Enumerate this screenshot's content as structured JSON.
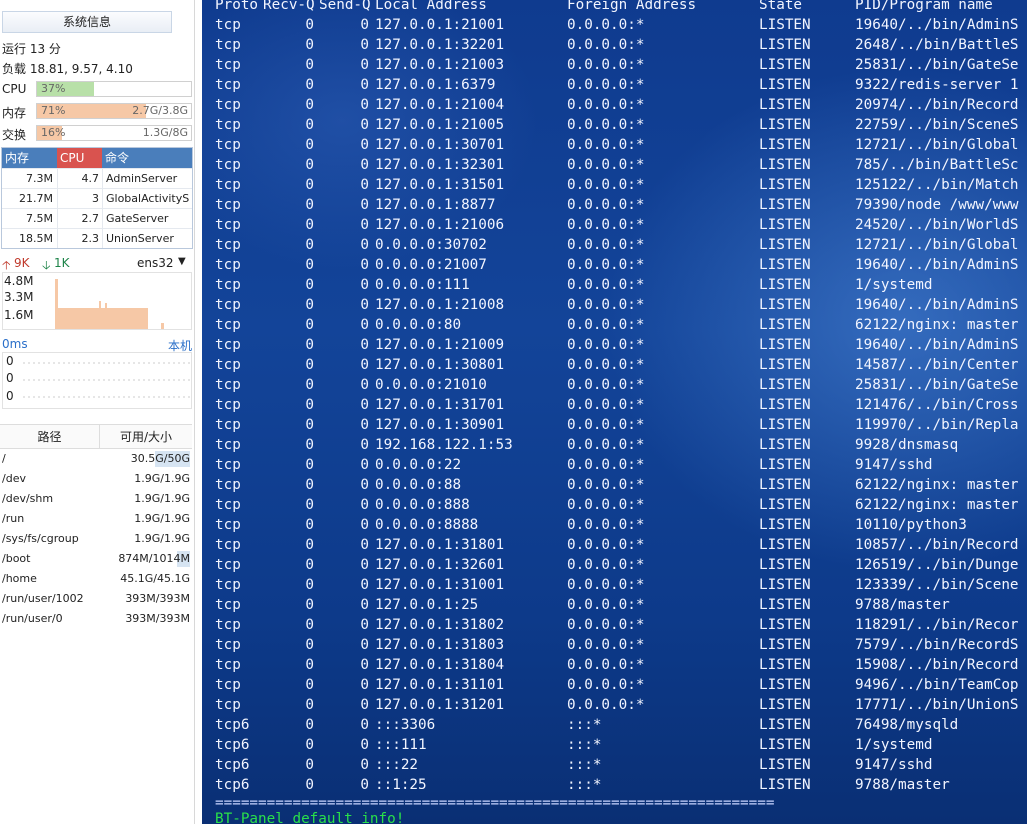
{
  "sidebar": {
    "sysinfo_button": "系统信息",
    "uptime": "运行 13 分",
    "load": "负载 18.81, 9.57, 4.10",
    "meters": [
      {
        "label": "CPU",
        "pct": "37%",
        "value": "",
        "fill": 0.37,
        "color": "#b8e0a8"
      },
      {
        "label": "内存",
        "pct": "71%",
        "value": "2.7G/3.8G",
        "fill": 0.71,
        "color": "#f6c8a6"
      },
      {
        "label": "交换",
        "pct": "16%",
        "value": "1.3G/8G",
        "fill": 0.16,
        "color": "#f6c8a6"
      }
    ],
    "process_table": {
      "headers": {
        "mem": "内存",
        "cpu": "CPU",
        "cmd": "命令"
      },
      "rows": [
        {
          "mem": "7.3M",
          "cpu": "4.7",
          "cmd": "AdminServer"
        },
        {
          "mem": "21.7M",
          "cpu": "3",
          "cmd": "GlobalActivityS"
        },
        {
          "mem": "7.5M",
          "cpu": "2.7",
          "cmd": "GateServer"
        },
        {
          "mem": "18.5M",
          "cpu": "2.3",
          "cmd": "UnionServer"
        }
      ]
    },
    "network": {
      "up": "9K",
      "down": "1K",
      "interface": "ens32",
      "y_labels": [
        "4.8M",
        "3.3M",
        "1.6M"
      ]
    },
    "ping": {
      "latency": "0ms",
      "host": "本机",
      "y_labels": [
        "0",
        "0",
        "0"
      ]
    },
    "disk": {
      "headers": {
        "path": "路径",
        "size": "可用/大小"
      },
      "rows": [
        {
          "path": "/",
          "size": "30.5G/50G",
          "fill": 0.39
        },
        {
          "path": "/dev",
          "size": "1.9G/1.9G",
          "fill": 0.0
        },
        {
          "path": "/dev/shm",
          "size": "1.9G/1.9G",
          "fill": 0.0
        },
        {
          "path": "/run",
          "size": "1.9G/1.9G",
          "fill": 0.0
        },
        {
          "path": "/sys/fs/cgroup",
          "size": "1.9G/1.9G",
          "fill": 0.0
        },
        {
          "path": "/boot",
          "size": "874M/1014M",
          "fill": 0.14
        },
        {
          "path": "/home",
          "size": "45.1G/45.1G",
          "fill": 0.0
        },
        {
          "path": "/run/user/1002",
          "size": "393M/393M",
          "fill": 0.0
        },
        {
          "path": "/run/user/0",
          "size": "393M/393M",
          "fill": 0.0
        }
      ]
    }
  },
  "terminal": {
    "headers": {
      "proto": "Proto",
      "recv": "Recv-Q",
      "send": "Send-Q",
      "local": "Local Address",
      "foreign": "Foreign Address",
      "state": "State",
      "pid": "PID/Program name"
    },
    "rows": [
      {
        "proto": "tcp",
        "recv": "0",
        "send": "0",
        "local": "127.0.0.1:21001",
        "foreign": "0.0.0.0:*",
        "state": "LISTEN",
        "pid": "19640/../bin/AdminS"
      },
      {
        "proto": "tcp",
        "recv": "0",
        "send": "0",
        "local": "127.0.0.1:32201",
        "foreign": "0.0.0.0:*",
        "state": "LISTEN",
        "pid": "2648/../bin/BattleS"
      },
      {
        "proto": "tcp",
        "recv": "0",
        "send": "0",
        "local": "127.0.0.1:21003",
        "foreign": "0.0.0.0:*",
        "state": "LISTEN",
        "pid": "25831/../bin/GateSe"
      },
      {
        "proto": "tcp",
        "recv": "0",
        "send": "0",
        "local": "127.0.0.1:6379",
        "foreign": "0.0.0.0:*",
        "state": "LISTEN",
        "pid": "9322/redis-server 1"
      },
      {
        "proto": "tcp",
        "recv": "0",
        "send": "0",
        "local": "127.0.0.1:21004",
        "foreign": "0.0.0.0:*",
        "state": "LISTEN",
        "pid": "20974/../bin/Record"
      },
      {
        "proto": "tcp",
        "recv": "0",
        "send": "0",
        "local": "127.0.0.1:21005",
        "foreign": "0.0.0.0:*",
        "state": "LISTEN",
        "pid": "22759/../bin/SceneS"
      },
      {
        "proto": "tcp",
        "recv": "0",
        "send": "0",
        "local": "127.0.0.1:30701",
        "foreign": "0.0.0.0:*",
        "state": "LISTEN",
        "pid": "12721/../bin/Global"
      },
      {
        "proto": "tcp",
        "recv": "0",
        "send": "0",
        "local": "127.0.0.1:32301",
        "foreign": "0.0.0.0:*",
        "state": "LISTEN",
        "pid": "785/../bin/BattleSc"
      },
      {
        "proto": "tcp",
        "recv": "0",
        "send": "0",
        "local": "127.0.0.1:31501",
        "foreign": "0.0.0.0:*",
        "state": "LISTEN",
        "pid": "125122/../bin/Match"
      },
      {
        "proto": "tcp",
        "recv": "0",
        "send": "0",
        "local": "127.0.0.1:8877",
        "foreign": "0.0.0.0:*",
        "state": "LISTEN",
        "pid": "79390/node /www/www"
      },
      {
        "proto": "tcp",
        "recv": "0",
        "send": "0",
        "local": "127.0.0.1:21006",
        "foreign": "0.0.0.0:*",
        "state": "LISTEN",
        "pid": "24520/../bin/WorldS"
      },
      {
        "proto": "tcp",
        "recv": "0",
        "send": "0",
        "local": "0.0.0.0:30702",
        "foreign": "0.0.0.0:*",
        "state": "LISTEN",
        "pid": "12721/../bin/Global"
      },
      {
        "proto": "tcp",
        "recv": "0",
        "send": "0",
        "local": "0.0.0.0:21007",
        "foreign": "0.0.0.0:*",
        "state": "LISTEN",
        "pid": "19640/../bin/AdminS"
      },
      {
        "proto": "tcp",
        "recv": "0",
        "send": "0",
        "local": "0.0.0.0:111",
        "foreign": "0.0.0.0:*",
        "state": "LISTEN",
        "pid": "1/systemd"
      },
      {
        "proto": "tcp",
        "recv": "0",
        "send": "0",
        "local": "127.0.0.1:21008",
        "foreign": "0.0.0.0:*",
        "state": "LISTEN",
        "pid": "19640/../bin/AdminS"
      },
      {
        "proto": "tcp",
        "recv": "0",
        "send": "0",
        "local": "0.0.0.0:80",
        "foreign": "0.0.0.0:*",
        "state": "LISTEN",
        "pid": "62122/nginx: master"
      },
      {
        "proto": "tcp",
        "recv": "0",
        "send": "0",
        "local": "127.0.0.1:21009",
        "foreign": "0.0.0.0:*",
        "state": "LISTEN",
        "pid": "19640/../bin/AdminS"
      },
      {
        "proto": "tcp",
        "recv": "0",
        "send": "0",
        "local": "127.0.0.1:30801",
        "foreign": "0.0.0.0:*",
        "state": "LISTEN",
        "pid": "14587/../bin/Center"
      },
      {
        "proto": "tcp",
        "recv": "0",
        "send": "0",
        "local": "0.0.0.0:21010",
        "foreign": "0.0.0.0:*",
        "state": "LISTEN",
        "pid": "25831/../bin/GateSe"
      },
      {
        "proto": "tcp",
        "recv": "0",
        "send": "0",
        "local": "127.0.0.1:31701",
        "foreign": "0.0.0.0:*",
        "state": "LISTEN",
        "pid": "121476/../bin/Cross"
      },
      {
        "proto": "tcp",
        "recv": "0",
        "send": "0",
        "local": "127.0.0.1:30901",
        "foreign": "0.0.0.0:*",
        "state": "LISTEN",
        "pid": "119970/../bin/Repla"
      },
      {
        "proto": "tcp",
        "recv": "0",
        "send": "0",
        "local": "192.168.122.1:53",
        "foreign": "0.0.0.0:*",
        "state": "LISTEN",
        "pid": "9928/dnsmasq"
      },
      {
        "proto": "tcp",
        "recv": "0",
        "send": "0",
        "local": "0.0.0.0:22",
        "foreign": "0.0.0.0:*",
        "state": "LISTEN",
        "pid": "9147/sshd"
      },
      {
        "proto": "tcp",
        "recv": "0",
        "send": "0",
        "local": "0.0.0.0:88",
        "foreign": "0.0.0.0:*",
        "state": "LISTEN",
        "pid": "62122/nginx: master"
      },
      {
        "proto": "tcp",
        "recv": "0",
        "send": "0",
        "local": "0.0.0.0:888",
        "foreign": "0.0.0.0:*",
        "state": "LISTEN",
        "pid": "62122/nginx: master"
      },
      {
        "proto": "tcp",
        "recv": "0",
        "send": "0",
        "local": "0.0.0.0:8888",
        "foreign": "0.0.0.0:*",
        "state": "LISTEN",
        "pid": "10110/python3"
      },
      {
        "proto": "tcp",
        "recv": "0",
        "send": "0",
        "local": "127.0.0.1:31801",
        "foreign": "0.0.0.0:*",
        "state": "LISTEN",
        "pid": "10857/../bin/Record"
      },
      {
        "proto": "tcp",
        "recv": "0",
        "send": "0",
        "local": "127.0.0.1:32601",
        "foreign": "0.0.0.0:*",
        "state": "LISTEN",
        "pid": "126519/../bin/Dunge"
      },
      {
        "proto": "tcp",
        "recv": "0",
        "send": "0",
        "local": "127.0.0.1:31001",
        "foreign": "0.0.0.0:*",
        "state": "LISTEN",
        "pid": "123339/../bin/Scene"
      },
      {
        "proto": "tcp",
        "recv": "0",
        "send": "0",
        "local": "127.0.0.1:25",
        "foreign": "0.0.0.0:*",
        "state": "LISTEN",
        "pid": "9788/master"
      },
      {
        "proto": "tcp",
        "recv": "0",
        "send": "0",
        "local": "127.0.0.1:31802",
        "foreign": "0.0.0.0:*",
        "state": "LISTEN",
        "pid": "118291/../bin/Recor"
      },
      {
        "proto": "tcp",
        "recv": "0",
        "send": "0",
        "local": "127.0.0.1:31803",
        "foreign": "0.0.0.0:*",
        "state": "LISTEN",
        "pid": "7579/../bin/RecordS"
      },
      {
        "proto": "tcp",
        "recv": "0",
        "send": "0",
        "local": "127.0.0.1:31804",
        "foreign": "0.0.0.0:*",
        "state": "LISTEN",
        "pid": "15908/../bin/Record"
      },
      {
        "proto": "tcp",
        "recv": "0",
        "send": "0",
        "local": "127.0.0.1:31101",
        "foreign": "0.0.0.0:*",
        "state": "LISTEN",
        "pid": "9496/../bin/TeamCop"
      },
      {
        "proto": "tcp",
        "recv": "0",
        "send": "0",
        "local": "127.0.0.1:31201",
        "foreign": "0.0.0.0:*",
        "state": "LISTEN",
        "pid": "17771/../bin/UnionS"
      },
      {
        "proto": "tcp6",
        "recv": "0",
        "send": "0",
        "local": ":::3306",
        "foreign": ":::*",
        "state": "LISTEN",
        "pid": "76498/mysqld"
      },
      {
        "proto": "tcp6",
        "recv": "0",
        "send": "0",
        "local": ":::111",
        "foreign": ":::*",
        "state": "LISTEN",
        "pid": "1/systemd"
      },
      {
        "proto": "tcp6",
        "recv": "0",
        "send": "0",
        "local": ":::22",
        "foreign": ":::*",
        "state": "LISTEN",
        "pid": "9147/sshd"
      },
      {
        "proto": "tcp6",
        "recv": "0",
        "send": "0",
        "local": "::1:25",
        "foreign": ":::*",
        "state": "LISTEN",
        "pid": "9788/master"
      }
    ],
    "separator": "=================================================================",
    "footer": "BT-Panel default info!"
  }
}
